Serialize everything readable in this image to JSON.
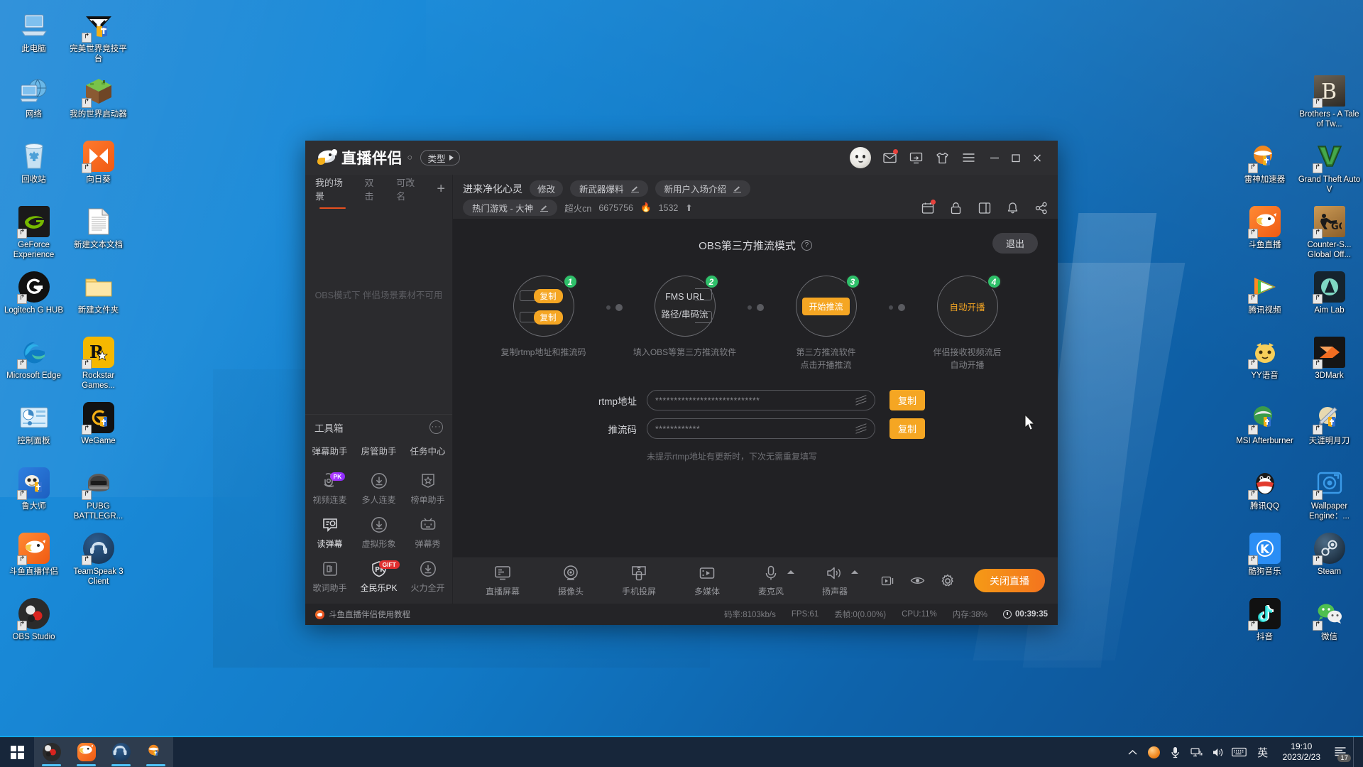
{
  "desktop": {
    "left_icons": [
      {
        "label": "此电脑",
        "icon": "this-pc-icon",
        "shortcut": false
      },
      {
        "label": "完美世界竞技平台",
        "icon": "perfect-world-arena-icon",
        "shortcut": true
      },
      {
        "label": "网络",
        "icon": "network-icon",
        "shortcut": false
      },
      {
        "label": "我的世界启动器",
        "icon": "minecraft-launcher-icon",
        "shortcut": true
      },
      {
        "label": "回收站",
        "icon": "recycle-bin-icon",
        "shortcut": false
      },
      {
        "label": "向日葵",
        "icon": "sunflower-remote-icon",
        "shortcut": true
      },
      {
        "label": "GeForce Experience",
        "icon": "geforce-experience-icon",
        "shortcut": true
      },
      {
        "label": "新建文本文档",
        "icon": "text-document-icon",
        "shortcut": false
      },
      {
        "label": "Logitech G HUB",
        "icon": "logitech-ghub-icon",
        "shortcut": true
      },
      {
        "label": "新建文件夹",
        "icon": "folder-icon",
        "shortcut": false
      },
      {
        "label": "Microsoft Edge",
        "icon": "edge-icon",
        "shortcut": true
      },
      {
        "label": "Rockstar Games...",
        "icon": "rockstar-games-icon",
        "shortcut": true
      },
      {
        "label": "控制面板",
        "icon": "control-panel-icon",
        "shortcut": false
      },
      {
        "label": "WeGame",
        "icon": "wegame-icon",
        "shortcut": true
      },
      {
        "label": "鲁大师",
        "icon": "ludashi-icon",
        "shortcut": true
      },
      {
        "label": "PUBG BATTLEGR...",
        "icon": "pubg-icon",
        "shortcut": true
      },
      {
        "label": "斗鱼直播伴侣",
        "icon": "douyu-companion-icon",
        "shortcut": true
      },
      {
        "label": "TeamSpeak 3 Client",
        "icon": "teamspeak-icon",
        "shortcut": true
      },
      {
        "label": "OBS Studio",
        "icon": "obs-studio-icon",
        "shortcut": true
      },
      {
        "label": "",
        "icon": "",
        "shortcut": false
      }
    ],
    "right_icons": [
      {
        "label": "",
        "icon": "",
        "shortcut": false
      },
      {
        "label": "Brothers - A Tale of Tw...",
        "icon": "brothers-game-icon",
        "shortcut": true
      },
      {
        "label": "雷神加速器",
        "icon": "leishen-accelerator-icon",
        "shortcut": true
      },
      {
        "label": "Grand Theft Auto V",
        "icon": "gta5-icon",
        "shortcut": true
      },
      {
        "label": "斗鱼直播",
        "icon": "douyu-live-icon",
        "shortcut": true
      },
      {
        "label": "Counter-S... Global Off...",
        "icon": "csgo-icon",
        "shortcut": true
      },
      {
        "label": "腾讯视频",
        "icon": "tencent-video-icon",
        "shortcut": true
      },
      {
        "label": "Aim Lab",
        "icon": "aim-lab-icon",
        "shortcut": true
      },
      {
        "label": "YY语音",
        "icon": "yy-voice-icon",
        "shortcut": true
      },
      {
        "label": "3DMark",
        "icon": "3dmark-icon",
        "shortcut": true
      },
      {
        "label": "MSI Afterburner",
        "icon": "msi-afterburner-icon",
        "shortcut": true
      },
      {
        "label": "天涯明月刀",
        "icon": "tianya-mingyuedao-icon",
        "shortcut": true
      },
      {
        "label": "腾讯QQ",
        "icon": "tencent-qq-icon",
        "shortcut": true
      },
      {
        "label": "Wallpaper Engine：...",
        "icon": "wallpaper-engine-icon",
        "shortcut": true
      },
      {
        "label": "酷狗音乐",
        "icon": "kugou-music-icon",
        "shortcut": true
      },
      {
        "label": "Steam",
        "icon": "steam-icon",
        "shortcut": true
      },
      {
        "label": "抖音",
        "icon": "douyin-icon",
        "shortcut": true
      },
      {
        "label": "微信",
        "icon": "wechat-icon",
        "shortcut": true
      }
    ]
  },
  "app": {
    "titlebar": {
      "brand": "直播伴侣",
      "type_label": "类型",
      "icons": [
        "mail-icon",
        "screen-share-icon",
        "shirt-icon",
        "menu-icon"
      ],
      "window_buttons": [
        "minimize",
        "maximize",
        "close"
      ]
    },
    "scene_panel": {
      "tabs": [
        {
          "label": "我的场景",
          "active": true
        },
        {
          "label": "双击",
          "active": false
        },
        {
          "label": "可改名",
          "active": false
        }
      ],
      "add_label": "+",
      "empty_text": "OBS模式下 伴侣场景素材不可用"
    },
    "toolbox": {
      "title": "工具箱",
      "more_label": "···",
      "assistants": [
        "弹幕助手",
        "房管助手",
        "任务中心"
      ],
      "tools": [
        {
          "label": "视频连麦",
          "icon": "video-mic-icon",
          "badge": "PK",
          "badge_type": "pk",
          "active": false
        },
        {
          "label": "多人连麦",
          "icon": "download-circle-icon",
          "badge": "",
          "badge_type": "",
          "active": false
        },
        {
          "label": "榜单助手",
          "icon": "ranking-icon",
          "badge": "",
          "badge_type": "",
          "active": false
        },
        {
          "label": "读弹幕",
          "icon": "read-danmaku-icon",
          "badge": "",
          "badge_type": "",
          "active": true
        },
        {
          "label": "虚拟形象",
          "icon": "download-circle-icon",
          "badge": "",
          "badge_type": "",
          "active": false
        },
        {
          "label": "弹幕秀",
          "icon": "danmaku-show-icon",
          "badge": "",
          "badge_type": "",
          "active": false
        },
        {
          "label": "歌词助手",
          "icon": "lyrics-icon",
          "badge": "",
          "badge_type": "",
          "active": false
        },
        {
          "label": "全民乐PK",
          "icon": "pk-shield-icon",
          "badge": "GIFT",
          "badge_type": "gift",
          "active": true
        },
        {
          "label": "火力全开",
          "icon": "download-circle-icon",
          "badge": "",
          "badge_type": "",
          "active": false
        }
      ]
    },
    "main_header": {
      "room_title": "进来净化心灵",
      "modify_label": "修改",
      "chips": [
        {
          "label": "新武器爆料",
          "edit": true
        },
        {
          "label": "新用户入场介绍",
          "edit": true
        }
      ],
      "category_chip": {
        "label": "热门游戏 - 大神",
        "edit": true
      },
      "nickname": "超火cn",
      "room_id": "6675756",
      "hot_value": "1532",
      "hot_icon": "flame-icon",
      "trend_icon": "arrow-up-icon",
      "action_icons": [
        "calendar-icon",
        "lock-icon",
        "layout-icon",
        "bell-icon",
        "share-icon"
      ]
    },
    "obs_panel": {
      "title": "OBS第三方推流模式",
      "help_icon": "question-icon",
      "quit_label": "退出",
      "steps": [
        {
          "num": "1",
          "inner": [
            "复制",
            "复制"
          ],
          "caption": "复制rtmp地址和推流码",
          "type": "copy"
        },
        {
          "num": "2",
          "inner": [
            "FMS URL",
            "路径/串码流"
          ],
          "caption": "填入OBS等第三方推流软件",
          "type": "fields"
        },
        {
          "num": "3",
          "inner": [
            "开始推流"
          ],
          "caption": "第三方推流软件\n点击开播推流",
          "type": "push"
        },
        {
          "num": "4",
          "inner": [
            "自动开播"
          ],
          "caption": "伴侣接收视频流后\n自动开播",
          "type": "auto"
        }
      ],
      "fields": [
        {
          "label": "rtmp地址",
          "value": "****************************",
          "copy_label": "复制",
          "toggle_icon": "eye-off-icon"
        },
        {
          "label": "推流码",
          "value": "************",
          "copy_label": "复制",
          "toggle_icon": "eye-off-icon"
        }
      ],
      "hint": "未提示rtmp地址有更新时，下次无需重复填写"
    },
    "bottom_bar": {
      "items": [
        {
          "label": "直播屏幕",
          "icon": "screen-icon",
          "caret": false
        },
        {
          "label": "摄像头",
          "icon": "camera-icon",
          "caret": false
        },
        {
          "label": "手机投屏",
          "icon": "phone-cast-icon",
          "caret": false
        },
        {
          "label": "多媒体",
          "icon": "media-icon",
          "caret": false
        },
        {
          "label": "麦克风",
          "icon": "microphone-icon",
          "caret": true
        },
        {
          "label": "扬声器",
          "icon": "speaker-icon",
          "caret": true
        }
      ],
      "right_icons": [
        "record-icon",
        "preview-eye-icon",
        "settings-gear-icon"
      ],
      "close_live_label": "关闭直播"
    },
    "status_bar": {
      "tutorial_label": "斗鱼直播伴侣使用教程",
      "bitrate": "码率:8103kb/s",
      "fps": "FPS:61",
      "dropped": "丢帧:0(0.00%)",
      "cpu": "CPU:11%",
      "memory": "内存:38%",
      "elapsed": "00:39:35"
    }
  },
  "taskbar": {
    "start_icon": "windows-start-icon",
    "apps": [
      {
        "icon": "obs-studio-icon",
        "active": true
      },
      {
        "icon": "douyu-companion-icon",
        "active": true
      },
      {
        "icon": "teamspeak-icon",
        "active": true
      },
      {
        "icon": "leishen-accelerator-icon",
        "active": true
      }
    ],
    "tray_icons": [
      "chevron-up-icon",
      "leishen-tray-icon",
      "microphone-tray-icon",
      "network-tray-icon",
      "volume-tray-icon",
      "keyboard-tray-icon"
    ],
    "ime_label": "英",
    "time": "19:10",
    "date": "2023/2/23",
    "notification_count": "17"
  },
  "colors": {
    "accent_orange": "#f5a623",
    "brand_red_orange": "#e8501f",
    "step_green": "#2fc06a",
    "window_bg": "#2b2b2e",
    "content_bg": "#212124",
    "taskbar_bg": "#17263a"
  }
}
